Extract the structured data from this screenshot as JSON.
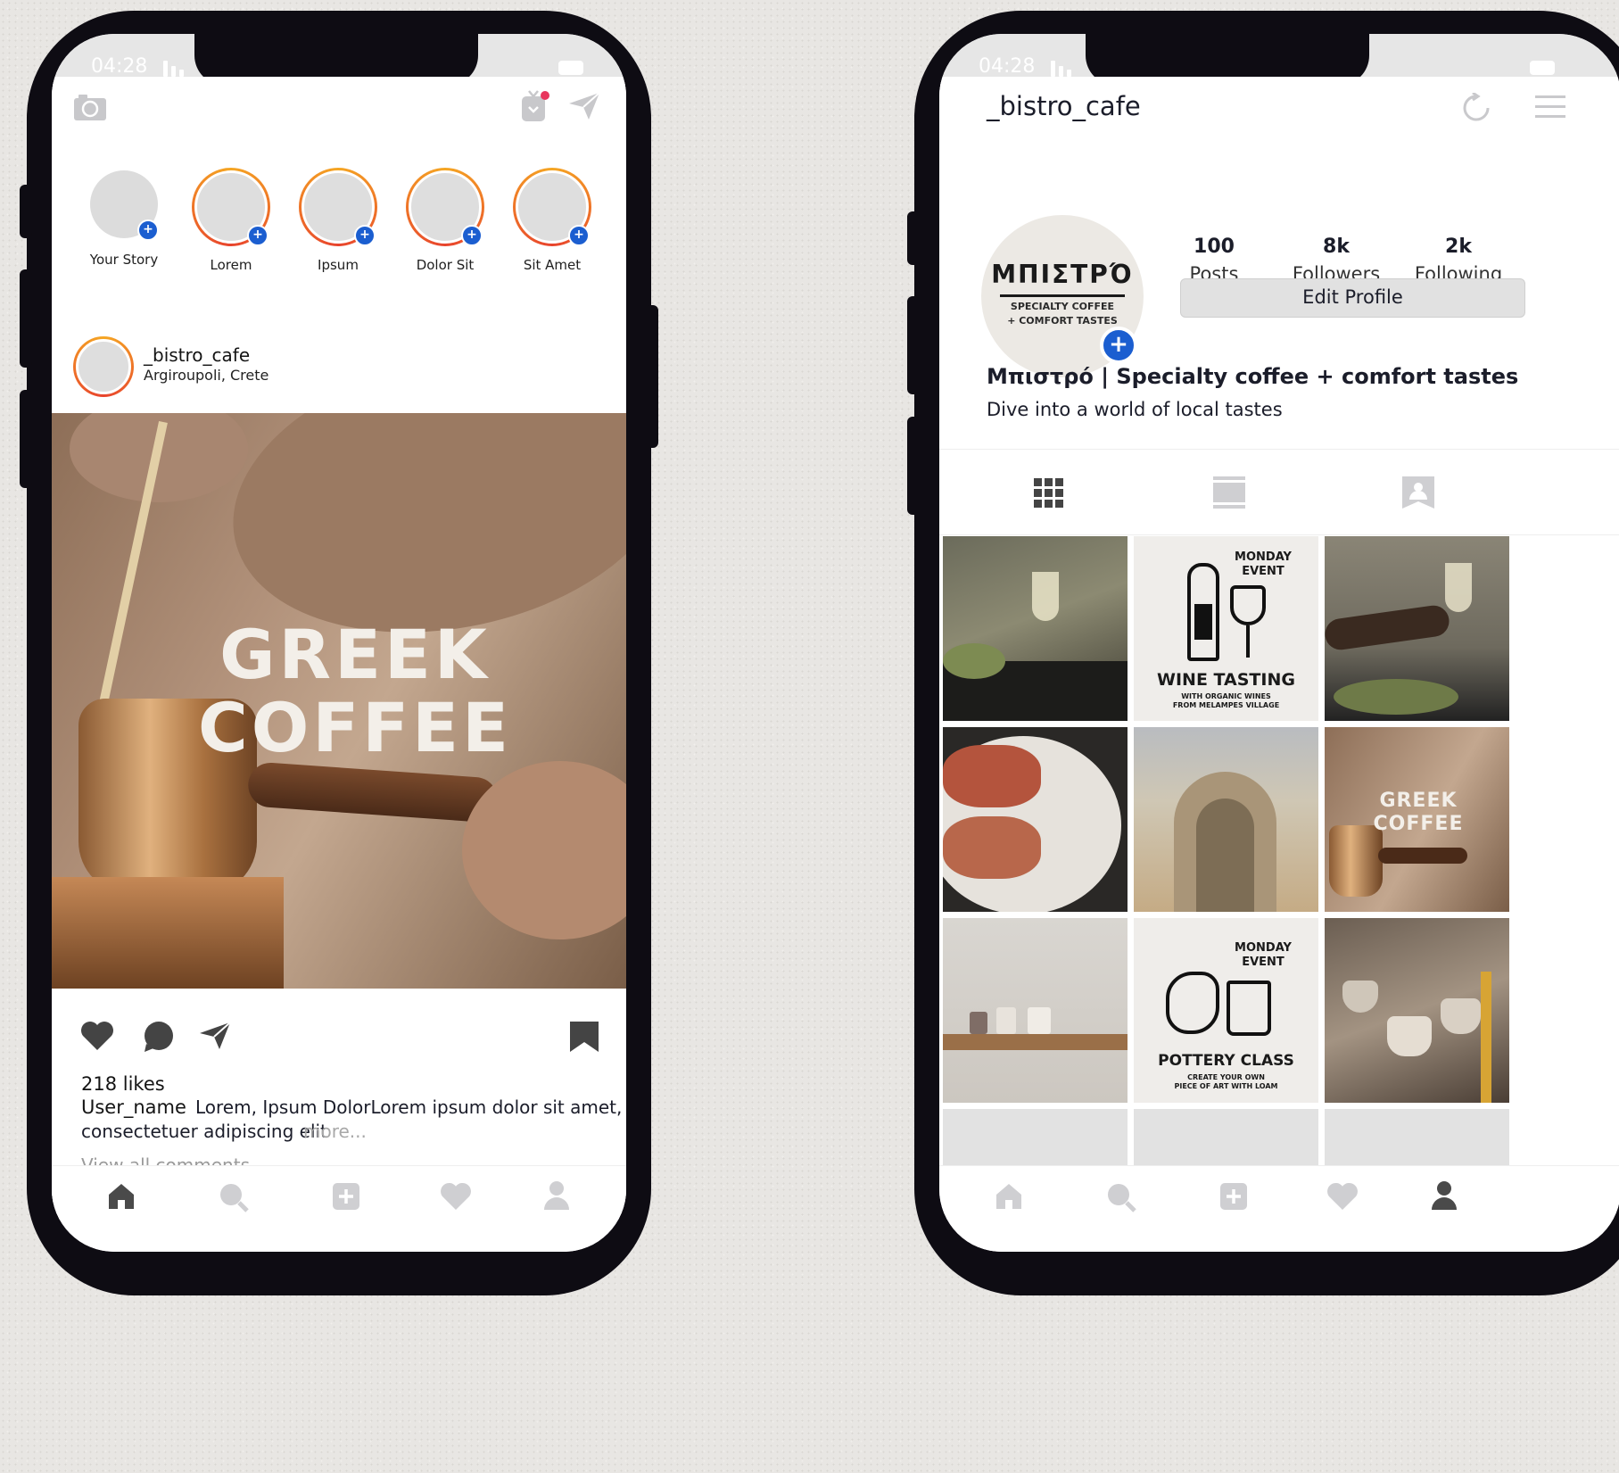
{
  "left_phone": {
    "status": {
      "time": "04:28"
    },
    "stories": [
      {
        "label": "Your Story",
        "has_ring": false
      },
      {
        "label": "Lorem",
        "has_ring": true
      },
      {
        "label": "Ipsum",
        "has_ring": true
      },
      {
        "label": "Dolor Sit",
        "has_ring": true
      },
      {
        "label": "Sit Amet",
        "has_ring": true
      }
    ],
    "post": {
      "username": "_bistro_cafe",
      "location": "Argiroupoli, Crete",
      "image_text_line1": "GREEK",
      "image_text_line2": "COFFEE",
      "likes": "218 likes",
      "caption_user": "User_name",
      "caption_text_1": "Lorem, Ipsum DolorLorem ipsum dolor sit amet,",
      "caption_text_2": "consectetuer adipiscing elit",
      "more": "more...",
      "view_comments": "View all comments"
    }
  },
  "right_phone": {
    "status": {
      "time": "04:28"
    },
    "header": {
      "username": "_bistro_cafe"
    },
    "profile": {
      "logo_title": "ΜΠΙΣΤΡΌ",
      "logo_line1": "SPECIALTY COFFEE",
      "logo_line2": "+ COMFORT TASTES",
      "stats": [
        {
          "num": "100",
          "label": "Posts"
        },
        {
          "num": "8k",
          "label": "Followers"
        },
        {
          "num": "2k",
          "label": "Following"
        }
      ],
      "edit_button": "Edit Profile",
      "bio_title": "Μπιστρό | Specialty coffee + comfort tastes",
      "bio_text": "Dive into a world of local tastes"
    },
    "grid": {
      "wine_event_title": "MONDAY EVENT",
      "wine_event_name": "WINE TASTING",
      "wine_event_sub1": "WITH ORGANIC WINES",
      "wine_event_sub2": "FROM MELAMPES VILLAGE",
      "coffee_line1": "GREEK",
      "coffee_line2": "COFFEE",
      "pottery_title": "MONDAY EVENT",
      "pottery_name": "POTTERY CLASS",
      "pottery_sub1": "CREATE YOUR OWN",
      "pottery_sub2": "PIECE OF ART WITH LOAM"
    }
  },
  "colors": {
    "phone_frame": "#0e0c13",
    "accent_blue": "#1b5ed0",
    "story_ring_orange": "#f5a623",
    "story_ring_red": "#e8432c",
    "notification_dot": "#e8365d"
  },
  "icons": [
    "camera-icon",
    "igtv-icon",
    "send-icon",
    "heart-icon",
    "comment-icon",
    "bookmark-icon",
    "home-icon",
    "search-icon",
    "add-icon",
    "profile-icon",
    "refresh-icon",
    "menu-icon",
    "grid-icon",
    "feed-icon",
    "tagged-icon"
  ]
}
